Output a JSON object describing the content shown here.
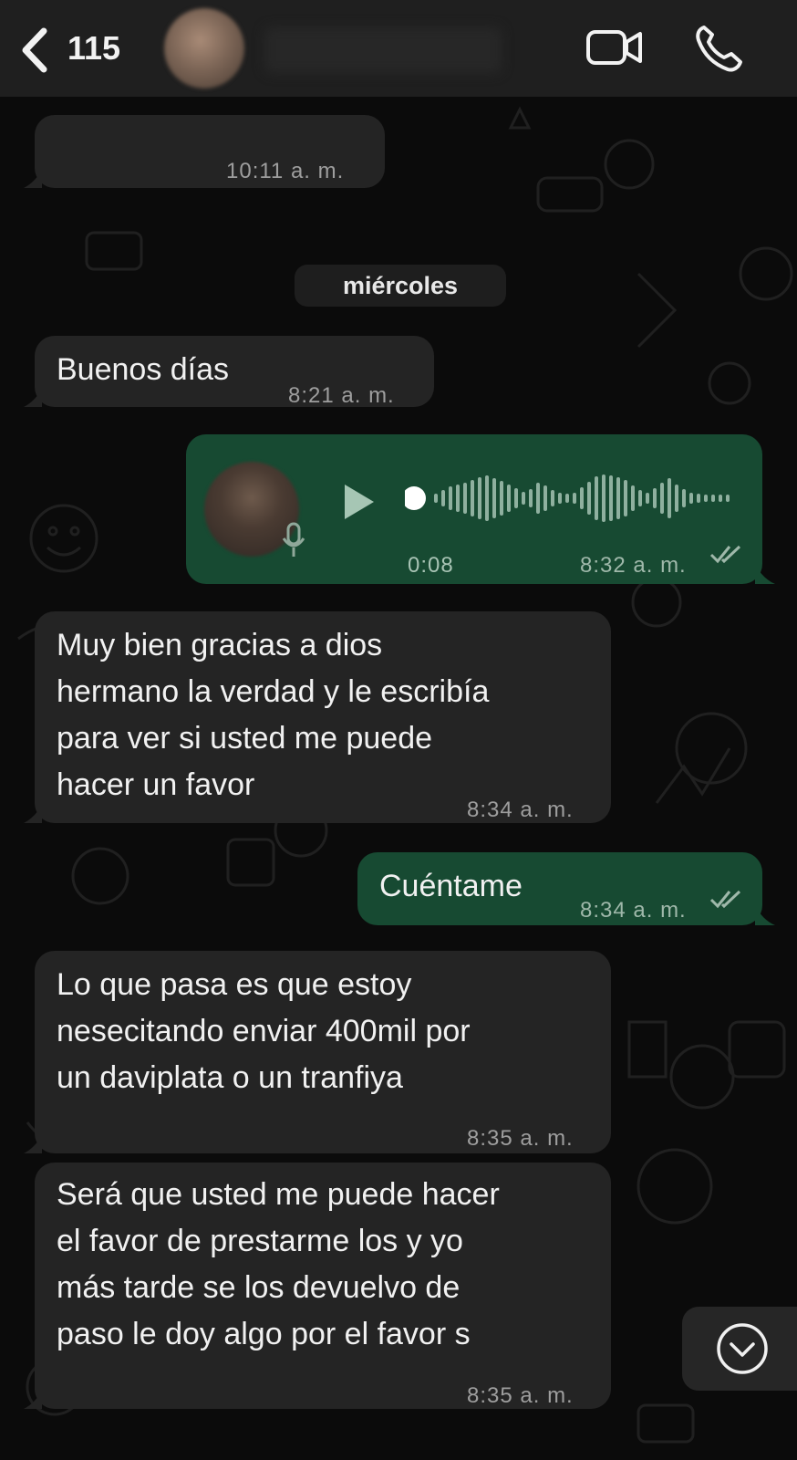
{
  "header": {
    "back_count": "115",
    "back_icon": "chevron-left-icon",
    "video_icon": "video-camera-icon",
    "call_icon": "phone-icon"
  },
  "day_separator": "miércoles",
  "messages": [
    {
      "direction": "in",
      "text": "",
      "time": "10:11 a. m."
    },
    {
      "direction": "in",
      "text": "Buenos días",
      "time": "8:21 a. m."
    },
    {
      "direction": "out",
      "type": "voice",
      "duration": "0:08",
      "time": "8:32 a. m.",
      "read": true
    },
    {
      "direction": "in",
      "text": "Muy bien gracias a dios\nhermano la verdad y le escribía\npara ver si usted me puede\nhacer un favor",
      "time": "8:34 a. m."
    },
    {
      "direction": "out",
      "text": "Cuéntame",
      "time": "8:34 a. m.",
      "read": true
    },
    {
      "direction": "in",
      "text": "Lo que pasa es que estoy\nnesecitando enviar 400mil por\nun daviplata o un tranfiya",
      "time": "8:35 a. m."
    },
    {
      "direction": "in",
      "text": "Será que usted me puede hacer\nel favor de prestarme los y yo\nmás tarde se los devuelvo de\npaso le doy algo por el favor s",
      "time": "8:35 a. m."
    }
  ],
  "colors": {
    "header_bg": "#1f1f1f",
    "incoming_bubble": "#242424",
    "outgoing_bubble": "#174a32",
    "background": "#0b0b0b"
  },
  "scroll_icon": "chevron-down-circle-icon"
}
